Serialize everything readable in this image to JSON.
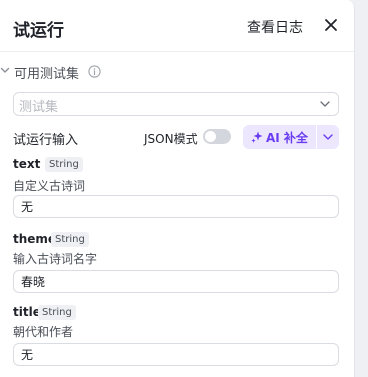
{
  "header": {
    "title": "试运行",
    "logs_link": "查看日志"
  },
  "test_set": {
    "label": "可用测试集",
    "select_placeholder": "测试集"
  },
  "run_input": {
    "label": "试运行输入",
    "json_mode_label": "JSON模式",
    "ai_button": "AI 补全"
  },
  "fields": [
    {
      "name": "text",
      "type": "String",
      "description": "自定义古诗词",
      "value": "无"
    },
    {
      "name": "theme",
      "type": "String",
      "description": "输入古诗词名字",
      "value": "春晓"
    },
    {
      "name": "title",
      "type": "String",
      "description": "朝代和作者",
      "value": "无"
    }
  ],
  "colors": {
    "accent": "#6a3df0",
    "accent_bg": "#ece7ff"
  }
}
